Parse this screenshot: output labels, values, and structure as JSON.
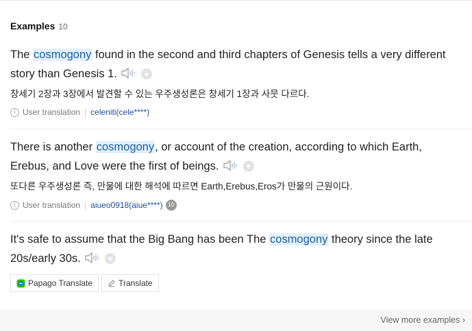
{
  "header": {
    "title": "Examples",
    "count": "10"
  },
  "examples": [
    {
      "pre": "The ",
      "hl": "cosmogony",
      "post": " found in the second and third chapters of Genesis tells a very different story than Genesis 1.",
      "translation": "창세기 2장과 3장에서 발견할 수 있는 우주생성론은 창세기 1장과 사뭇 다르다.",
      "source": "User translation",
      "user": "celeniti(cele****)"
    },
    {
      "pre": "There is another ",
      "hl": "cosmogony",
      "post": ", or account of the creation, according to which Earth, Erebus, and Love were the first of beings.",
      "translation": "또다른 우주생성론 즉, 만물에 대한 해석에 따르면 Earth,Erebus,Eros가 만물의 근원이다.",
      "source": "User translation",
      "user": "aiueo0918(aiue****)",
      "badge": "10"
    },
    {
      "pre": "It's safe to assume that the Big Bang has been The ",
      "hl": "cosmogony",
      "post": " theory since the late 20s/early 30s.",
      "buttons": {
        "papago": "Papago Translate",
        "translate": "Translate"
      }
    }
  ],
  "footer": {
    "more": "View more examples"
  },
  "icons": {
    "speaker": "speaker-icon",
    "plus": "plus-icon",
    "info": "info-icon",
    "papago": "papago-logo-icon",
    "pencil": "pencil-icon",
    "chevron": "chevron-right-icon"
  },
  "colors": {
    "highlight_bg": "#e3f0fa",
    "highlight_text": "#1c5fa8",
    "link": "#1d4e96"
  }
}
